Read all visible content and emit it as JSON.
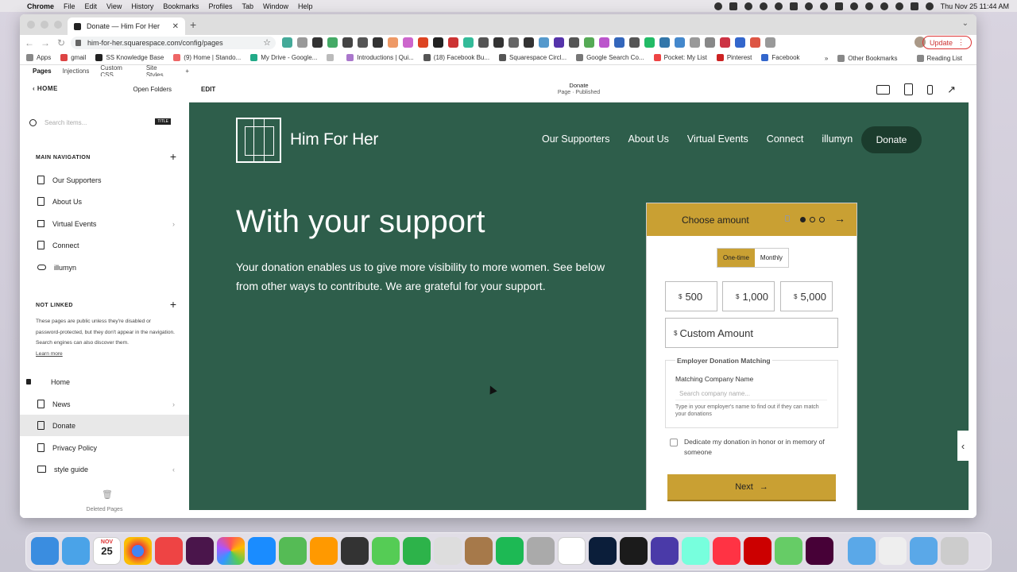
{
  "menubar": {
    "app": "Chrome",
    "items": [
      "File",
      "Edit",
      "View",
      "History",
      "Bookmarks",
      "Profiles",
      "Tab",
      "Window",
      "Help"
    ],
    "clock": "Thu Nov 25  11:44 AM"
  },
  "browser": {
    "tab_title": "Donate — Him For Her",
    "url": "him-for-her.squarespace.com/config/pages",
    "update_label": "Update",
    "bookmarks": [
      {
        "label": "Apps",
        "color": "#888"
      },
      {
        "label": "gmail",
        "color": "#d44"
      },
      {
        "label": "SS Knowledge Base",
        "color": "#222"
      },
      {
        "label": "(9) Home | Stando...",
        "color": "#e66"
      },
      {
        "label": "My Drive - Google...",
        "color": "#2a8"
      },
      {
        "label": "",
        "color": "#bbb"
      },
      {
        "label": "Introductions | Qui...",
        "color": "#a7c"
      },
      {
        "label": "(18) Facebook Bu...",
        "color": "#555"
      },
      {
        "label": "Squarespace Circl...",
        "color": "#555"
      },
      {
        "label": "Google Search Co...",
        "color": "#777"
      },
      {
        "label": "Pocket: My List",
        "color": "#e44"
      },
      {
        "label": "Pinterest",
        "color": "#c22"
      },
      {
        "label": "Facebook",
        "color": "#36c"
      }
    ],
    "bookmarks_more": "»",
    "other_bookmarks": "Other Bookmarks",
    "reading_list": "Reading List"
  },
  "squarespace": {
    "top_tabs": [
      "Pages",
      "Injections",
      "Custom CSS",
      "Site Styles",
      "+"
    ],
    "home_label": "HOME",
    "open_folders": "Open Folders",
    "search_placeholder": "Search items...",
    "search_tag": "TITLE",
    "main_nav_title": "MAIN NAVIGATION",
    "main_nav": [
      {
        "label": "Our Supporters",
        "chevron": ""
      },
      {
        "label": "About Us",
        "chevron": ""
      },
      {
        "label": "Virtual Events",
        "chevron": "›"
      },
      {
        "label": "Connect",
        "chevron": ""
      },
      {
        "label": "illumyn",
        "chevron": ""
      }
    ],
    "not_linked_title": "NOT LINKED",
    "not_linked_text": "These pages are public unless they're disabled or password-protected, but they don't appear in the navigation. Search engines can also discover them.",
    "learn_more": "Learn more",
    "not_linked": [
      {
        "label": "Home",
        "chevron": ""
      },
      {
        "label": "News",
        "chevron": "›"
      },
      {
        "label": "Donate",
        "chevron": ""
      },
      {
        "label": "Privacy Policy",
        "chevron": ""
      },
      {
        "label": "style guide",
        "chevron": "‹"
      }
    ],
    "deleted_pages": "Deleted Pages",
    "edit_label": "EDIT",
    "page_name": "Donate",
    "page_status": "Page · Published"
  },
  "site": {
    "logo_text": "Him For Her",
    "nav": [
      "Our Supporters",
      "About Us",
      "Virtual Events",
      "Connect",
      "illumyn"
    ],
    "donate_button": "Donate",
    "headline": "With your support",
    "body": "Your donation enables us to give more visibility to more women. See below from other ways to contribute. We are grateful for your support."
  },
  "donation_form": {
    "header": "Choose amount",
    "one_time": "One-time",
    "monthly": "Monthly",
    "currency": "$",
    "amounts": [
      "500",
      "1,000",
      "5,000"
    ],
    "custom_placeholder": "Custom Amount",
    "employer_legend": "Employer Donation Matching",
    "company_label": "Matching Company Name",
    "company_placeholder": "Search company name...",
    "company_help": "Type in your employer's name to find out if they can match your donations",
    "honor_text": "Dedicate my donation in honor or in memory of someone",
    "next_label": "Next",
    "brand_color": "#c9a033",
    "site_bg": "#2e5e4b"
  },
  "dock": {
    "calendar_month": "NOV",
    "calendar_day": "25"
  }
}
